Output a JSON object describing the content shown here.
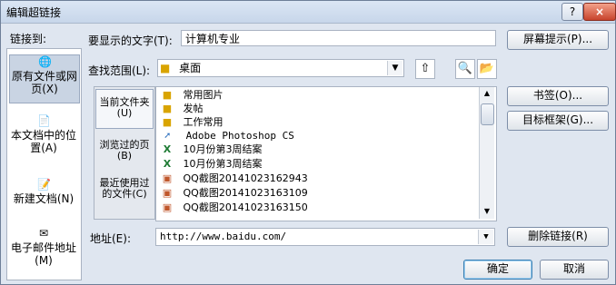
{
  "window": {
    "title": "编辑超链接",
    "help_label": "?",
    "close_label": "×"
  },
  "sidebar": {
    "header": "链接到:",
    "items": [
      {
        "label": "原有文件或网页(X)",
        "icon": "globe-page-icon"
      },
      {
        "label": "本文档中的位置(A)",
        "icon": "document-location-icon"
      },
      {
        "label": "新建文档(N)",
        "icon": "new-document-icon"
      },
      {
        "label": "电子邮件地址(M)",
        "icon": "email-icon"
      }
    ]
  },
  "display_text": {
    "label": "要显示的文字(T):",
    "value": "计算机专业"
  },
  "screen_tip_label": "屏幕提示(P)...",
  "lookin": {
    "label": "查找范围(L):",
    "value": "桌面"
  },
  "panel": {
    "items": [
      {
        "label": "当前文件夹(U)"
      },
      {
        "label": "浏览过的页(B)"
      },
      {
        "label": "最近使用过的文件(C)"
      }
    ]
  },
  "files": [
    {
      "name": "常用图片",
      "icon": "folder-icon"
    },
    {
      "name": "发帖",
      "icon": "folder-icon"
    },
    {
      "name": "工作常用",
      "icon": "folder-icon"
    },
    {
      "name": "Adobe Photoshop CS",
      "icon": "shortcut-icon"
    },
    {
      "name": "10月份第3周结案",
      "icon": "excel-file-icon"
    },
    {
      "name": "10月份第3周结案",
      "icon": "excel-file-icon"
    },
    {
      "name": "QQ截图20141023162943",
      "icon": "image-file-icon"
    },
    {
      "name": "QQ截图20141023163109",
      "icon": "image-file-icon"
    },
    {
      "name": "QQ截图20141023163150",
      "icon": "image-file-icon"
    }
  ],
  "right_buttons": {
    "bookmark": "书签(O)...",
    "target_frame": "目标框架(G)...",
    "remove_link": "删除链接(R)"
  },
  "address": {
    "label": "地址(E):",
    "value": "http://www.baidu.com/"
  },
  "ok_label": "确定",
  "cancel_label": "取消",
  "colors": {
    "accent": "#c9d4e3",
    "close": "#c7432c"
  }
}
